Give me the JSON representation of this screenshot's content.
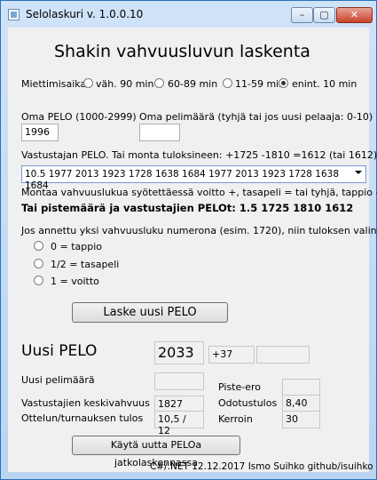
{
  "window": {
    "title": "Selolaskuri v. 1.0.0.10"
  },
  "heading": "Shakin vahvuusluvun laskenta",
  "time_control": {
    "label": "Miettimisaika:",
    "options": [
      "väh. 90 min",
      "60-89 min",
      "11-59 min",
      "enint. 10 min"
    ],
    "selected": "enint. 10 min"
  },
  "own_pelo": {
    "label": "Oma PELO (1000-2999)",
    "value": "1996"
  },
  "own_games": {
    "label": "Oma pelimäärä (tyhjä tai jos uusi pelaaja: 0-10)",
    "value": ""
  },
  "opponents": {
    "label": "Vastustajan PELO. Tai monta tuloksineen: +1725 -1810 =1612 (tai 1612)",
    "value": "10.5 1977 2013 1923 1728 1638 1684 1977 2013 1923 1728 1638 1684",
    "help": "Montaa vahvuuslukua syötettäessä voitto +,   tasapeli = tai tyhjä,   tappio -",
    "example": "Tai pistemäärä ja vastustajien PELOt: 1.5 1725 1810 1612"
  },
  "single_result": {
    "label": "Jos annettu yksi vahvuusluku numerona (esim. 1720), niin tuloksen valinta:",
    "options": [
      "0 = tappio",
      "1/2 = tasapeli",
      "1 = voitto"
    ]
  },
  "calc_button": "Laske uusi PELO",
  "results": {
    "new_pelo_label": "Uusi PELO",
    "new_pelo": "2033",
    "change": "+37",
    "extra": "",
    "new_games_label": "Uusi pelimäärä",
    "new_games": "",
    "diff_label": "Piste-ero",
    "diff": "",
    "avg_label": "Vastustajien keskivahvuus",
    "avg": "1827",
    "expected_label": "Odotustulos",
    "expected": "8,40",
    "result_label": "Ottelun/turnauksen tulos",
    "result": "10,5 / 12",
    "factor_label": "Kerroin",
    "factor": "30"
  },
  "reuse_button": "Käytä uutta PELOa jatkolaskennassa",
  "footer": "C#/.NET 12.12.2017 Ismo Suihko github/isuihko",
  "colors": {
    "titlebar": "#b9d5f2",
    "close": "#c7432b",
    "client": "#f0f0f0"
  }
}
